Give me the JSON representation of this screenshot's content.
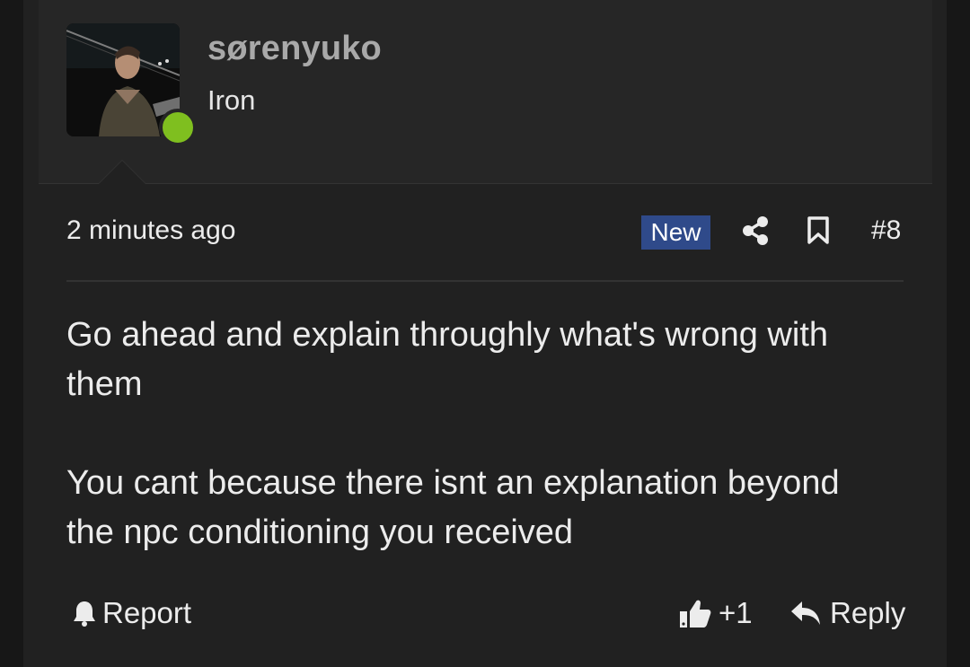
{
  "post": {
    "author": {
      "username": "sørenyuko",
      "title": "Iron",
      "online": true,
      "avatar": "man-in-dark-photo"
    },
    "timestamp": "2 minutes ago",
    "badge": "New",
    "post_number": "#8",
    "icons": {
      "share": "share-icon",
      "bookmark": "bookmark-icon",
      "report": "bell-icon",
      "like": "thumbs-up-icon",
      "reply": "reply-arrow-icon"
    },
    "body": [
      "Go ahead and explain throughly what's wrong with them",
      "You cant because there isnt an explanation beyond the npc conditioning you received"
    ],
    "actions": {
      "report_label": "Report",
      "like_count": "+1",
      "reply_label": "Reply"
    }
  },
  "colors": {
    "background": "#212121",
    "user_block": "#262626",
    "username": "#a9a9a9",
    "text": "#ececec",
    "badge_new": "#2f4a8a",
    "online": "#7fbf1f"
  }
}
